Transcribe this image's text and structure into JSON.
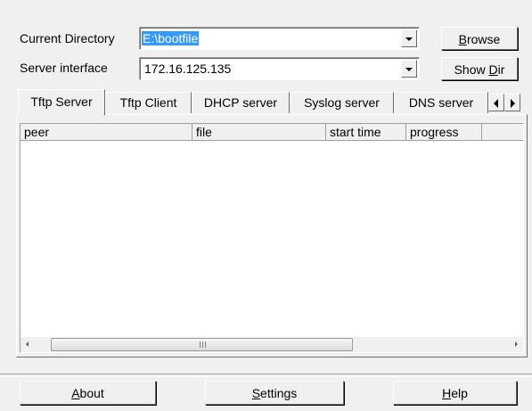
{
  "form": {
    "current_directory_label": "Current Directory",
    "current_directory_value": "E:\\bootfile",
    "server_interface_label": "Server interface",
    "server_interface_value": "172.16.125.135",
    "browse_button_pre": "",
    "browse_button_key": "B",
    "browse_button_post": "rowse",
    "show_dir_button_pre": "Show ",
    "show_dir_button_key": "D",
    "show_dir_button_post": "ir"
  },
  "tabs": [
    {
      "label": "Tftp Server",
      "active": true
    },
    {
      "label": "Tftp Client",
      "active": false
    },
    {
      "label": "DHCP server",
      "active": false
    },
    {
      "label": "Syslog server",
      "active": false
    },
    {
      "label": "DNS server",
      "active": false
    }
  ],
  "table": {
    "columns": [
      "peer",
      "file",
      "start time",
      "progress"
    ],
    "rows": [],
    "scrollbar_grip": "III"
  },
  "footer": {
    "about_key": "A",
    "about_rest": "bout",
    "settings_key": "S",
    "settings_rest": "ettings",
    "help_key": "H",
    "help_rest": "elp"
  }
}
